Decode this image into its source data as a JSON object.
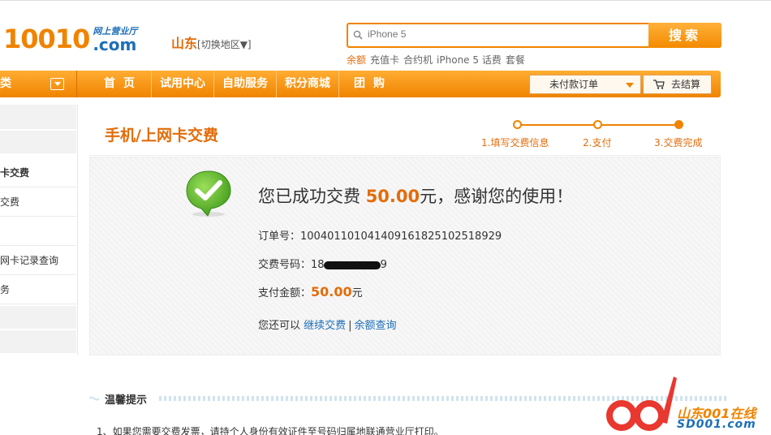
{
  "header": {
    "logo_number": "10010",
    "logo_cn": "网上营业厅",
    "logo_com": ".com",
    "region": "山东",
    "region_switch": "[切换地区▼]"
  },
  "search": {
    "placeholder": "iPhone 5",
    "button_label": "搜索",
    "hotwords": [
      "余额",
      "充值卡",
      "合约机",
      "iPhone 5 话费",
      "套餐"
    ]
  },
  "nav": {
    "category_label": "类",
    "items": [
      "首页",
      "试用中心",
      "自助服务",
      "积分商城",
      "团购"
    ],
    "order_select": "未付款订单",
    "checkout_label": "去结算"
  },
  "sidebar": {
    "items": [
      "卡交费",
      "交费",
      "",
      "网卡记录查询",
      "务"
    ]
  },
  "page": {
    "title": "手机/上网卡交费",
    "steps": [
      "1.填写交费信息",
      "2.支付",
      "3.交费完成"
    ]
  },
  "result": {
    "success_prefix": "您已成功交费 ",
    "success_amount": "50.00",
    "success_suffix": "元，感谢您的使用！",
    "order_label": "订单号：",
    "order_number": "100401101041409161825102518929",
    "pay_code_label": "交费号码：",
    "pay_code_visible_start": "18",
    "pay_code_visible_end": "9",
    "amount_label": "支付金额：",
    "amount_value": "50.00",
    "amount_unit": "元",
    "more_prefix": "您还可以 ",
    "continue_link": "继续交费",
    "separator": "|",
    "balance_link": "余额查询"
  },
  "tips": {
    "title": "温馨提示",
    "line1": "1、如果您需要交费发票，请持个人身份有效证件至号码归属地联通营业厅打印。"
  },
  "watermark": {
    "cn": "山东001在线",
    "en": "SD001.com"
  },
  "colors": {
    "brand_orange": "#f08300",
    "link_blue": "#1d6fb8"
  }
}
